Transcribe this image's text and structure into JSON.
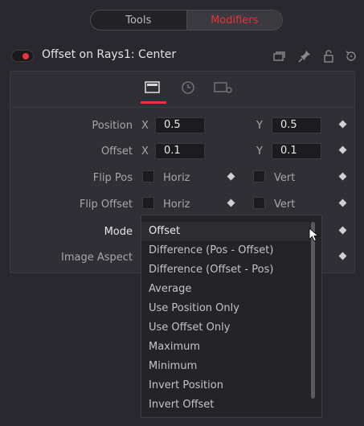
{
  "tabs": {
    "tools_label": "Tools",
    "modifiers_label": "Modifiers"
  },
  "header": {
    "title": "Offset on Rays1: Center",
    "enabled": true,
    "icons": [
      "stack-icon",
      "pin-icon",
      "lock-icon",
      "reset-icon"
    ]
  },
  "panel_tabs": [
    "controls-icon",
    "clock-icon",
    "settings-icon"
  ],
  "params": {
    "position": {
      "label": "Position",
      "x_axis": "X",
      "x_value": "0.5",
      "y_axis": "Y",
      "y_value": "0.5"
    },
    "offset": {
      "label": "Offset",
      "x_axis": "X",
      "x_value": "0.1",
      "y_axis": "Y",
      "y_value": "0.1"
    },
    "flip_pos": {
      "label": "Flip Pos",
      "horiz": "Horiz",
      "vert": "Vert"
    },
    "flip_offset": {
      "label": "Flip Offset",
      "horiz": "Horiz",
      "vert": "Vert"
    },
    "mode": {
      "label": "Mode"
    },
    "image_aspect": {
      "label": "Image Aspect"
    }
  },
  "mode_dropdown": {
    "selected": "Offset",
    "options": [
      "Offset",
      "Difference (Pos - Offset)",
      "Difference (Offset - Pos)",
      "Average",
      "Use Position Only",
      "Use Offset Only",
      "Maximum",
      "Minimum",
      "Invert Position",
      "Invert Offset"
    ]
  },
  "colors": {
    "accent": "#e8353b",
    "background": "#28282e",
    "panel": "#2f2f35"
  }
}
